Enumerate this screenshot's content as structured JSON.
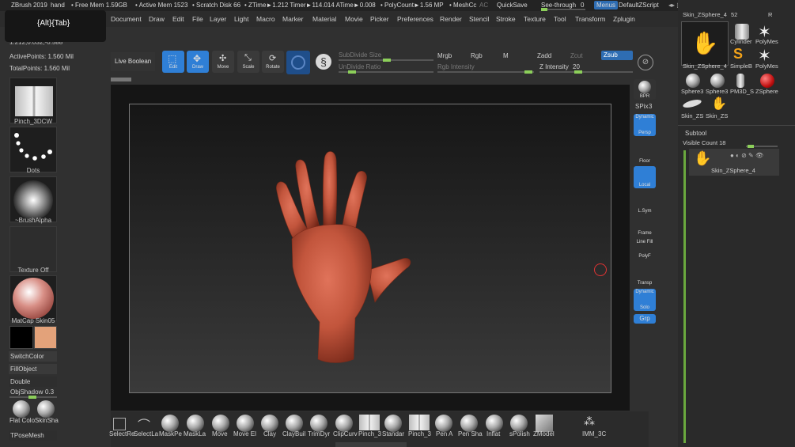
{
  "alttab": "{Alt}{Tab}",
  "titlebar": {
    "app": "ZBrush 2019",
    "doc": "hand",
    "free_mem": "• Free Mem 1.59GB",
    "active_mem": "• Active Mem 1523",
    "scratch": "• Scratch Disk 66",
    "ztime": "• ZTime►1.212 Timer►114.014 ATime►0.008",
    "polycount": "• PolyCount►1.56 MP",
    "meshcount": "• MeshCc",
    "ac": "AC",
    "quicksave": "QuickSave",
    "seethrough": "See-through",
    "seethrough_val": "0",
    "menus": "Menus",
    "script": "DefaultZScript"
  },
  "menubar": [
    "Document",
    "Draw",
    "Edit",
    "File",
    "Layer",
    "Light",
    "Macro",
    "Marker",
    "Material",
    "Movie",
    "Picker",
    "Preferences",
    "Render",
    "Stencil",
    "Stroke",
    "Texture",
    "Tool",
    "Transform",
    "Zplugin"
  ],
  "leftinfo": {
    "coords": "1.212,0.032,-0.588",
    "active_points": "ActivePoints: 1.560 Mil",
    "total_points": "TotalPoints: 1.560 Mil"
  },
  "leftshelf": {
    "brush": "Pinch_3DCW",
    "stroke": "Dots",
    "alpha": "~BrushAlpha",
    "texture": "Texture Off",
    "material": "MatCap Skin05",
    "switchcolor": "SwitchColor",
    "fillobject": "FillObject",
    "double": "Double",
    "objshadow": "ObjShadow",
    "objshadow_val": "0.3",
    "flatcolor": "Flat Colo",
    "skinshade": "SkinSha",
    "tposemesh": "TPoseMesh"
  },
  "toolbar": {
    "live_boolean": "Live Boolean",
    "edit": "Edit",
    "draw": "Draw",
    "move": "Move",
    "scale": "Scale",
    "rotate": "Rotate",
    "subdivide_size": "SubDivide Size",
    "undivide_ratio": "UnDivide Ratio",
    "mrgb": "Mrgb",
    "rgb": "Rgb",
    "m": "M",
    "zadd": "Zadd",
    "zsub": "Zsub",
    "zcut": "Zcut",
    "rgb_intensity": "Rgb Intensity",
    "z_intensity": "Z Intensity",
    "z_intensity_val": "20"
  },
  "righttools": {
    "bpr": "BPR",
    "spix": "SPix",
    "spix_val": "3",
    "dynamic": "Dynamic",
    "persp": "Persp",
    "floor": "Floor",
    "local": "Local",
    "lsym": "L.Sym",
    "frame": "Frame",
    "linefill": "Line Fill",
    "polyf": "PolyF",
    "transp": "Transp",
    "dynamic2": "Dynamic",
    "solo": "Solo",
    "grp": "Grp"
  },
  "toolpanel": {
    "current": "Skin_ZSphere_4",
    "current_count": "52",
    "r": "R",
    "items": [
      "Skin_ZSphere_4",
      "Cylinder",
      "PolyMes",
      "SimpleB",
      "PolyMes",
      "Sphere3",
      "Sphere3",
      "PM3D_S",
      "ZSphere",
      "Skin_ZS",
      "Skin_ZS"
    ]
  },
  "subtool": {
    "title": "Subtool",
    "visible_count": "Visible Count 18",
    "item": "Skin_ZSphere_4"
  },
  "brushes": [
    "SelectRe",
    "SelectLa",
    "MaskPe",
    "MaskLa",
    "Move",
    "Move El",
    "Clay",
    "ClayBuil",
    "TrimDyr",
    "ClipCurv",
    "Pinch_3",
    "Standar",
    "Pinch_3",
    "Pen A",
    "Pen Sha",
    "Inflat",
    "sPolish",
    "ZModel",
    "IMM_3C"
  ],
  "colors": {
    "accent": "#2f7fd6",
    "green": "#8ccf5a",
    "skin": "#c2553c",
    "secondary_color": "#e3a27a"
  }
}
